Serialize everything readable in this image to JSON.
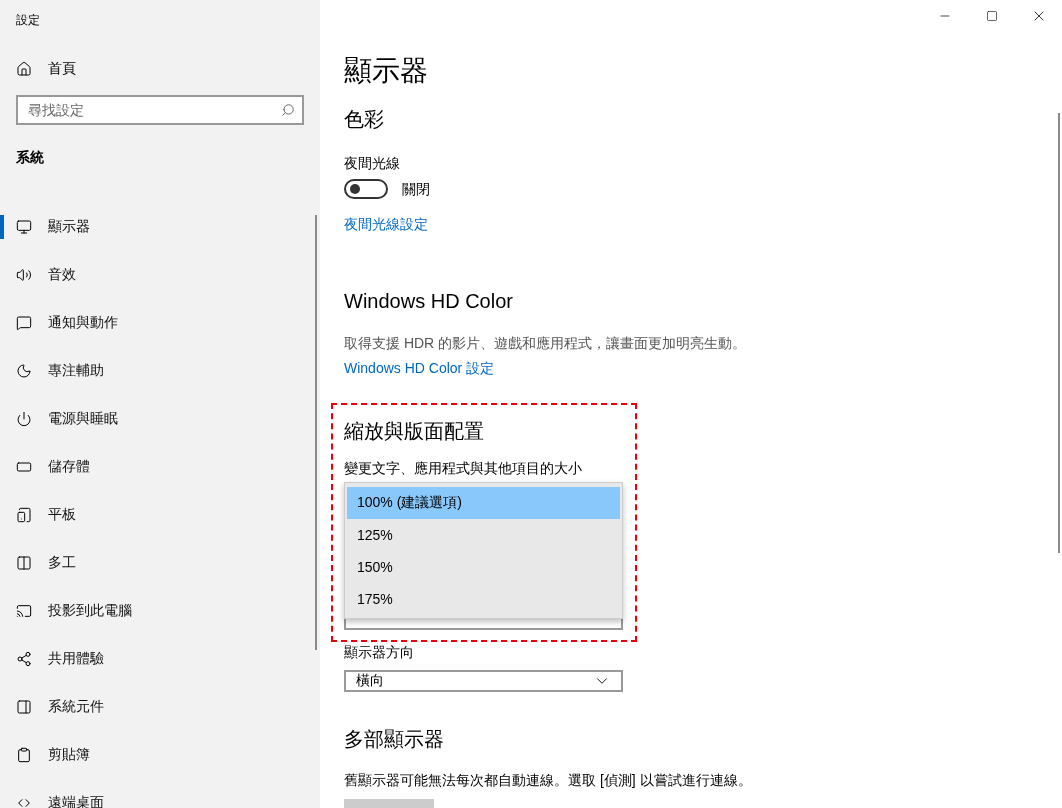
{
  "window": {
    "title": "設定"
  },
  "sidebar": {
    "home": "首頁",
    "search": {
      "placeholder": "尋找設定"
    },
    "section": "系統",
    "items": [
      {
        "label": "顯示器",
        "selected": true
      },
      {
        "label": "音效",
        "selected": false
      },
      {
        "label": "通知與動作",
        "selected": false
      },
      {
        "label": "專注輔助",
        "selected": false
      },
      {
        "label": "電源與睡眠",
        "selected": false
      },
      {
        "label": "儲存體",
        "selected": false
      },
      {
        "label": "平板",
        "selected": false
      },
      {
        "label": "多工",
        "selected": false
      },
      {
        "label": "投影到此電腦",
        "selected": false
      },
      {
        "label": "共用體驗",
        "selected": false
      },
      {
        "label": "系統元件",
        "selected": false
      },
      {
        "label": "剪貼簿",
        "selected": false
      },
      {
        "label": "遠端桌面",
        "selected": false
      }
    ]
  },
  "main": {
    "title": "顯示器",
    "color": {
      "heading": "色彩",
      "night_light": {
        "label": "夜間光線",
        "on": false,
        "state_text": "關閉"
      },
      "link": "夜間光線設定"
    },
    "hd_color": {
      "heading": "Windows HD Color",
      "description": "取得支援 HDR 的影片、遊戲和應用程式，讓畫面更加明亮生動。",
      "link": "Windows HD Color 設定"
    },
    "scale_layout": {
      "heading": "縮放與版面配置",
      "scale_label": "變更文字、應用程式與其他項目的大小",
      "expanded": true,
      "options": [
        {
          "label": "100% (建議選項)",
          "selected": true
        },
        {
          "label": "125%",
          "selected": false
        },
        {
          "label": "150%",
          "selected": false
        },
        {
          "label": "175%",
          "selected": false
        }
      ],
      "orientation": {
        "label": "顯示器方向",
        "value": "橫向"
      }
    },
    "multiple_displays": {
      "heading": "多部顯示器",
      "description": "舊顯示器可能無法每次都自動連線。選取 [偵測] 以嘗試進行連線。"
    }
  }
}
